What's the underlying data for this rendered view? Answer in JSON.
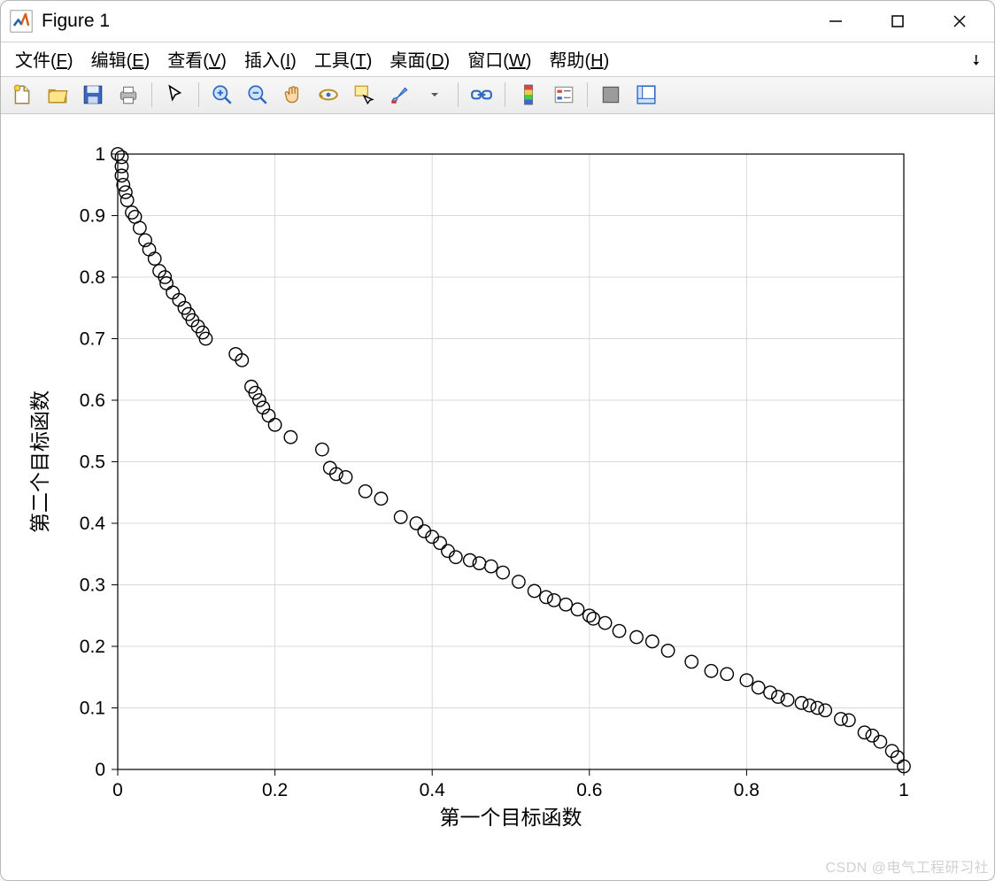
{
  "window": {
    "title": "Figure 1"
  },
  "menu": {
    "file": {
      "label": "文件",
      "accel": "F"
    },
    "edit": {
      "label": "编辑",
      "accel": "E"
    },
    "view": {
      "label": "查看",
      "accel": "V"
    },
    "insert": {
      "label": "插入",
      "accel": "I"
    },
    "tools": {
      "label": "工具",
      "accel": "T"
    },
    "desktop": {
      "label": "桌面",
      "accel": "D"
    },
    "window": {
      "label": "窗口",
      "accel": "W"
    },
    "help": {
      "label": "帮助",
      "accel": "H"
    }
  },
  "toolbar": {
    "new": "New Figure",
    "open": "Open File",
    "save": "Save Figure",
    "print": "Print Figure",
    "edit_plot": "Edit Plot",
    "zoom_in": "Zoom In",
    "zoom_out": "Zoom Out",
    "pan": "Pan",
    "rotate3d": "Rotate 3D",
    "data_cursor": "Data Cursor",
    "brush": "Brush",
    "link": "Link Plot",
    "colorbar": "Insert Colorbar",
    "legend": "Insert Legend",
    "hide_tools": "Hide Plot Tools",
    "show_tools": "Show Plot Tools"
  },
  "watermark": "CSDN @电气工程研习社",
  "chart_data": {
    "type": "scatter",
    "xlabel": "第一个目标函数",
    "ylabel": "第二个目标函数",
    "xlim": [
      0,
      1
    ],
    "ylim": [
      0,
      1
    ],
    "xticks": [
      0,
      0.2,
      0.4,
      0.6,
      0.8,
      1
    ],
    "yticks": [
      0,
      0.1,
      0.2,
      0.3,
      0.4,
      0.5,
      0.6,
      0.7,
      0.8,
      0.9,
      1
    ],
    "x": [
      0.0,
      0.005,
      0.005,
      0.005,
      0.007,
      0.01,
      0.012,
      0.018,
      0.022,
      0.028,
      0.035,
      0.04,
      0.047,
      0.053,
      0.06,
      0.062,
      0.07,
      0.078,
      0.085,
      0.09,
      0.095,
      0.102,
      0.108,
      0.112,
      0.15,
      0.158,
      0.17,
      0.175,
      0.18,
      0.185,
      0.192,
      0.2,
      0.22,
      0.26,
      0.27,
      0.278,
      0.29,
      0.315,
      0.335,
      0.36,
      0.38,
      0.39,
      0.4,
      0.41,
      0.42,
      0.43,
      0.448,
      0.46,
      0.475,
      0.49,
      0.51,
      0.53,
      0.545,
      0.555,
      0.57,
      0.585,
      0.6,
      0.605,
      0.62,
      0.638,
      0.66,
      0.68,
      0.7,
      0.73,
      0.755,
      0.775,
      0.8,
      0.815,
      0.83,
      0.84,
      0.852,
      0.87,
      0.88,
      0.89,
      0.9,
      0.92,
      0.93,
      0.95,
      0.96,
      0.97,
      0.985,
      0.992,
      1.0
    ],
    "y": [
      1.0,
      0.995,
      0.98,
      0.965,
      0.95,
      0.938,
      0.925,
      0.905,
      0.898,
      0.88,
      0.86,
      0.845,
      0.83,
      0.81,
      0.8,
      0.79,
      0.775,
      0.763,
      0.75,
      0.74,
      0.73,
      0.72,
      0.71,
      0.7,
      0.675,
      0.665,
      0.622,
      0.612,
      0.6,
      0.588,
      0.575,
      0.56,
      0.54,
      0.52,
      0.49,
      0.48,
      0.475,
      0.452,
      0.44,
      0.41,
      0.4,
      0.387,
      0.378,
      0.368,
      0.355,
      0.345,
      0.34,
      0.335,
      0.33,
      0.32,
      0.305,
      0.29,
      0.28,
      0.275,
      0.268,
      0.26,
      0.25,
      0.245,
      0.238,
      0.225,
      0.215,
      0.208,
      0.193,
      0.175,
      0.16,
      0.155,
      0.145,
      0.133,
      0.125,
      0.118,
      0.113,
      0.108,
      0.104,
      0.1,
      0.096,
      0.082,
      0.08,
      0.06,
      0.055,
      0.045,
      0.03,
      0.02,
      0.005
    ]
  }
}
